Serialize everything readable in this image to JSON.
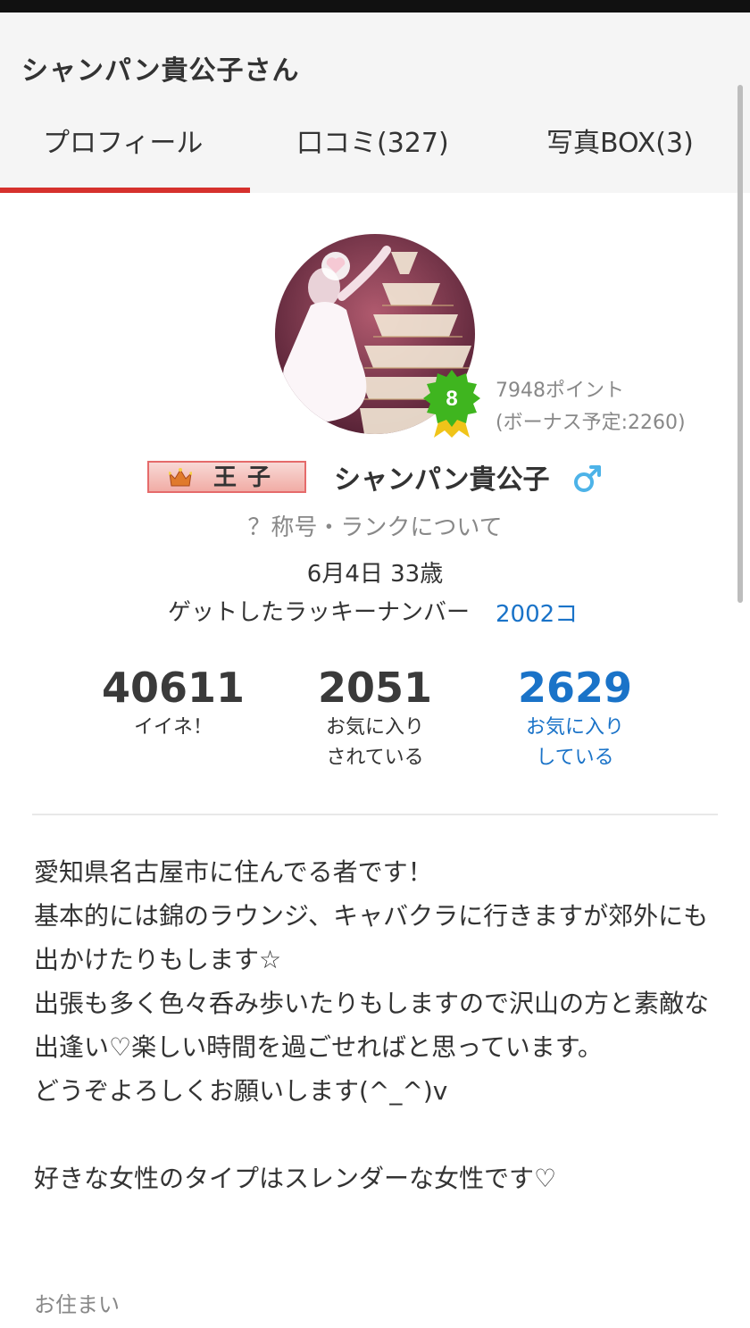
{
  "header": {
    "title": "シャンパン貴公子さん"
  },
  "tabs": [
    {
      "label": "プロフィール",
      "active": true
    },
    {
      "label": "口コミ(327)",
      "active": false
    },
    {
      "label": "写真BOX(3)",
      "active": false
    }
  ],
  "profile": {
    "rank_level": "8",
    "points": "7948ポイント",
    "bonus": "(ボーナス予定:2260)",
    "title_badge": "王子",
    "username": "シャンパン貴公子",
    "gender_icon": "male-icon",
    "rank_info_link": "？称号・ランクについて",
    "birthday": "6月4日 33歳",
    "lucky_label": "ゲットしたラッキーナンバー",
    "lucky_value": "2002コ"
  },
  "stats": [
    {
      "value": "40611",
      "label1": "イイネ！",
      "label2": ""
    },
    {
      "value": "2051",
      "label1": "お気に入り",
      "label2": "されている"
    },
    {
      "value": "2629",
      "label1": "お気に入り",
      "label2": "している"
    }
  ],
  "bio": {
    "lines": [
      "愛知県名古屋市に住んでる者です！",
      "基本的には錦のラウンジ、キャバクラに行きますが郊外にも出かけたりもします☆",
      "出張も多く色々呑み歩いたりもしますので沢山の方と素敵な出逢い♡楽しい時間を過ごせればと思っています。",
      "どうぞよろしくお願いします(^_^)v",
      "",
      "好きな女性のタイプはスレンダーな女性です♡"
    ]
  },
  "residence": {
    "label": "お住まい"
  },
  "colors": {
    "accent": "#d6312d",
    "link": "#1a73c8",
    "rank_badge": "#3fb51f"
  }
}
